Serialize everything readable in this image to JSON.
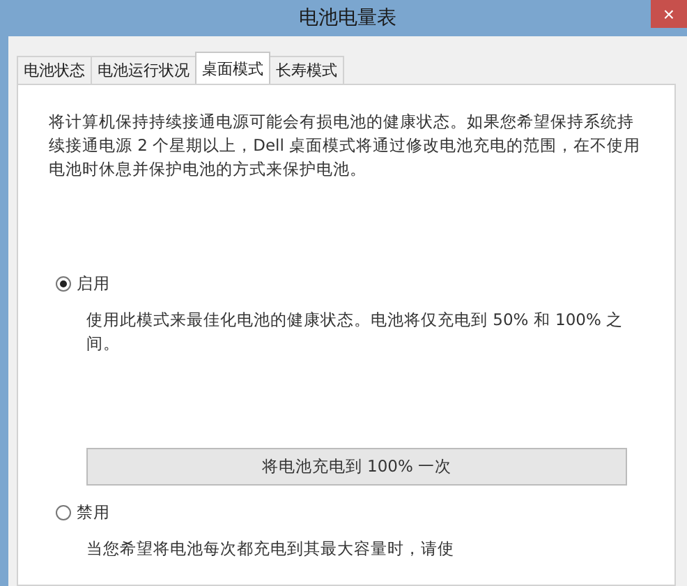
{
  "window": {
    "title": "电池电量表",
    "close": "×"
  },
  "tabs": [
    {
      "label": "电池状态",
      "selected": false
    },
    {
      "label": "电池运行状况",
      "selected": false
    },
    {
      "label": "桌面模式",
      "selected": true
    },
    {
      "label": "长寿模式",
      "selected": false
    }
  ],
  "intro": "将计算机保持持续接通电源可能会有损电池的健康状态。如果您希望保持系统持续接通电源 2 个星期以上，Dell 桌面模式将通过修改电池充电的范围，在不使用电池时休息并保护电池的方式来保护电池。",
  "options": [
    {
      "label": "启用",
      "selected": true,
      "description": "使用此模式来最佳化电池的健康状态。电池将仅充电到 50% 和 100% 之间。",
      "button": "将电池充电到 100% 一次"
    },
    {
      "label": "禁用",
      "selected": false,
      "description": "当您希望将电池每次都充电到其最大容量时，请使"
    }
  ]
}
